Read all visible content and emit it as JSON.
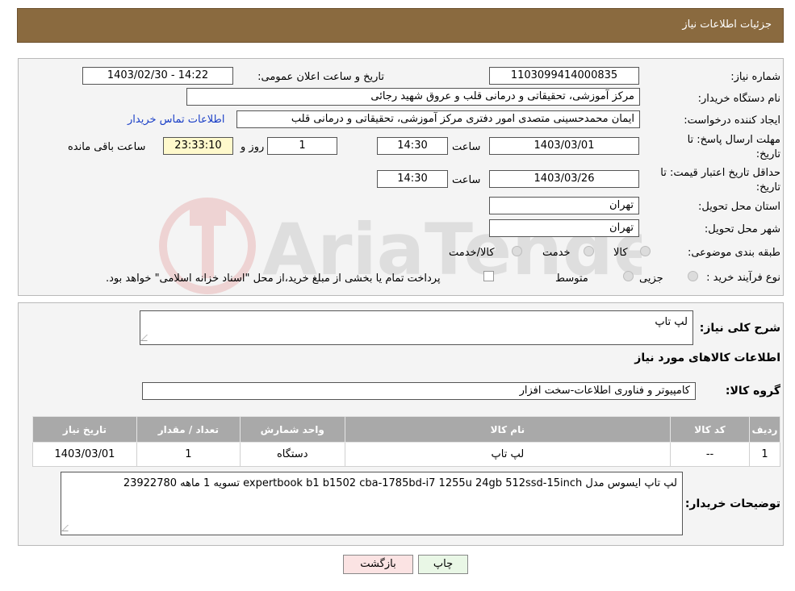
{
  "header": {
    "title": "جزئیات اطلاعات نیاز"
  },
  "form": {
    "need_number_label": "شماره نیاز:",
    "need_number": "1103099414000835",
    "announce_label": "تاریخ و ساعت اعلان عمومی:",
    "announce_value": "1403/02/30 - 14:22",
    "buyer_org_label": "نام دستگاه خریدار:",
    "buyer_org": "مرکز آموزشی، تحقیقاتی و درمانی قلب و عروق شهید رجائی",
    "creator_label": "ایجاد کننده درخواست:",
    "creator": "ایمان محمدحسینی متصدی امور دفتری مرکز آموزشی، تحقیقاتی و درمانی قلب",
    "contact_link": "اطلاعات تماس خریدار",
    "deadline_label": "مهلت ارسال پاسخ: تا تاریخ:",
    "deadline_date": "1403/03/01",
    "time_label": "ساعت",
    "deadline_time": "14:30",
    "days_value": "1",
    "days_label": "روز و",
    "remaining_time": "23:33:10",
    "remaining_label": "ساعت باقی مانده",
    "validity_label": "حداقل تاریخ اعتبار قیمت: تا تاریخ:",
    "validity_date": "1403/03/26",
    "validity_time": "14:30",
    "province_label": "استان محل تحویل:",
    "province": "تهران",
    "city_label": "شهر محل تحویل:",
    "city": "تهران",
    "category_label": "طبقه بندی موضوعی:",
    "category_options": [
      "کالا",
      "خدمت",
      "کالا/خدمت"
    ],
    "purchase_type_label": "نوع فرآیند خرید :",
    "purchase_options": [
      "جزیی",
      "متوسط"
    ],
    "purchase_note": "پرداخت تمام یا بخشی از مبلغ خرید،از محل \"اسناد خزانه اسلامی\" خواهد بود."
  },
  "details": {
    "summary_label": "شرح کلی نیاز:",
    "summary": "لپ تاپ",
    "items_title": "اطلاعات کالاهای مورد نیاز",
    "group_label": "گروه کالا:",
    "group": "کامپیوتر و فناوری اطلاعات-سخت افزار",
    "table": {
      "headers": [
        "ردیف",
        "کد کالا",
        "نام کالا",
        "واحد شمارش",
        "تعداد / مقدار",
        "تاریخ نیاز"
      ],
      "rows": [
        [
          "1",
          "--",
          "لپ تاپ",
          "دستگاه",
          "1",
          "1403/03/01"
        ]
      ]
    },
    "buyer_notes_label": "توضیحات خریدار:",
    "buyer_notes": "لپ تاپ ایسوس مدل expertbook b1 b1502 cba-1785bd-i7 1255u 24gb 512ssd-15inch تسویه 1 ماهه 23922780"
  },
  "buttons": {
    "print": "چاپ",
    "back": "بازگشت"
  },
  "watermark": "AriaTender.neT",
  "colors": {
    "header": "#8a6a3f",
    "link": "#1a3fc7",
    "highlight": "#fff9cc"
  }
}
